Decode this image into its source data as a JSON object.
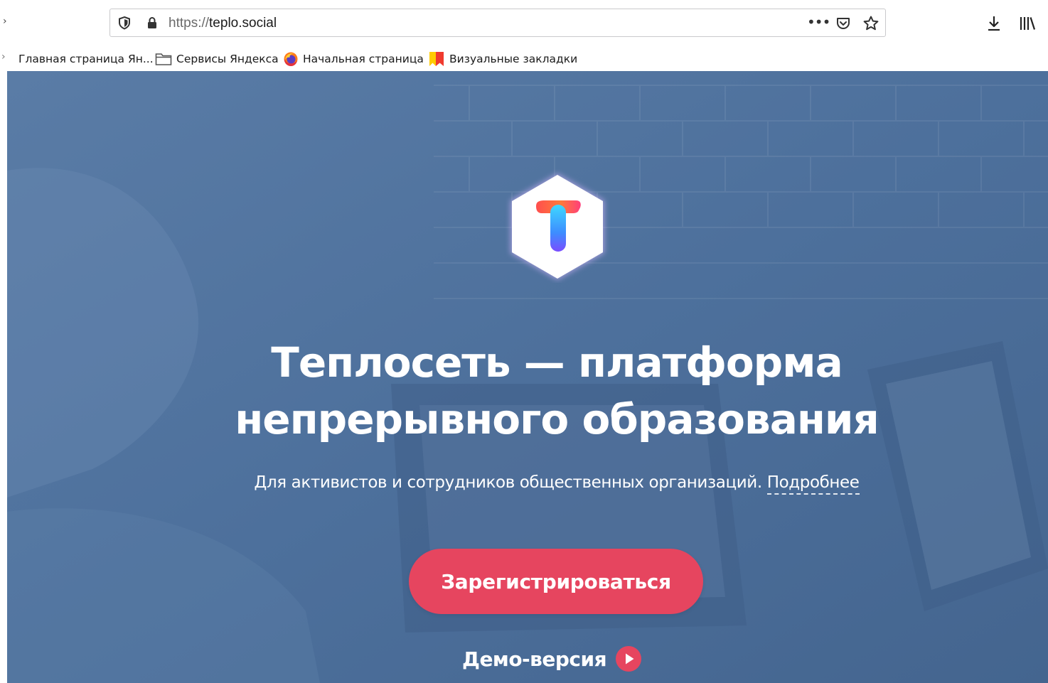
{
  "browser": {
    "url_scheme": "https://",
    "url_host": "teplo.social",
    "more_label": "•••"
  },
  "bookmarks": [
    {
      "label": "Главная страница Ян...",
      "icon": "chevron-icon"
    },
    {
      "label": "Сервисы Яндекса",
      "icon": "folder-icon"
    },
    {
      "label": "Начальная страница",
      "icon": "firefox-icon"
    },
    {
      "label": "Визуальные закладки",
      "icon": "visual-bookmarks-icon"
    }
  ],
  "hero": {
    "headline_line1": "Теплосеть — платформа",
    "headline_line2": "непрерывного образования",
    "subline": "Для активистов и сотрудников общественных организаций.",
    "more_link": "Подробнее",
    "register_label": "Зарегистрироваться",
    "demo_label": "Демо-версия"
  },
  "colors": {
    "hero_bg": "#4c6f9b",
    "register_button": "#e6455f",
    "text": "#ffffff"
  }
}
